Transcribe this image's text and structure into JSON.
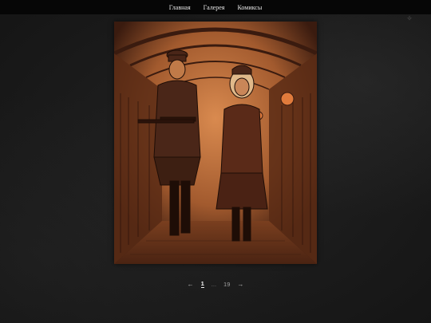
{
  "nav": {
    "items": [
      {
        "label": "Главная"
      },
      {
        "label": "Галерея"
      },
      {
        "label": "Комиксы"
      }
    ]
  },
  "artwork": {
    "icon": "comic-illustration",
    "palette": {
      "base": "#a25a2e",
      "shadow": "#3a1b0f",
      "highlight": "#d98a4f",
      "lamp": "#e07b3c"
    }
  },
  "pagination": {
    "prev": "←",
    "current": "1",
    "ellipsis": "...",
    "last": "19",
    "next": "→"
  }
}
